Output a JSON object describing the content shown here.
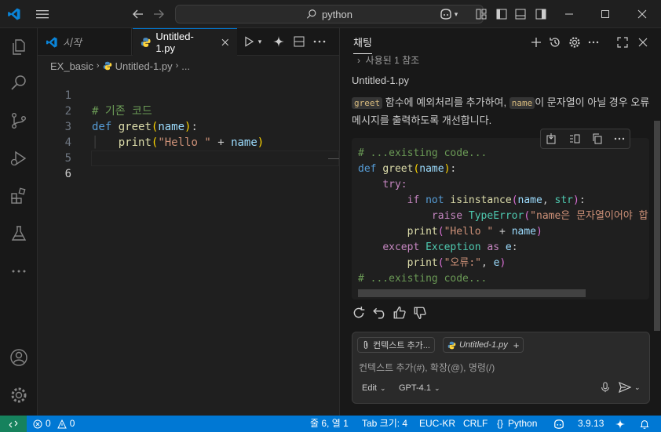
{
  "titlebar": {
    "search": "python",
    "colors": {
      "bg": "#1f1f1f",
      "accent": "#0078d4"
    }
  },
  "activitybar": {
    "items": [
      "explorer-icon",
      "search-icon",
      "source-control-icon",
      "run-debug-icon",
      "extensions-icon",
      "testing-icon",
      "more-icon",
      "account-icon",
      "settings-gear-icon"
    ]
  },
  "editor": {
    "tabs": [
      {
        "label": "시작"
      },
      {
        "label": "Untitled-1.py"
      }
    ],
    "breadcrumb": [
      "EX_basic",
      "Untitled-1.py",
      "..."
    ],
    "lines": [
      {
        "n": "1",
        "text": "# 기존 코드"
      },
      {
        "n": "2",
        "text": "def greet(name):"
      },
      {
        "n": "3",
        "text": "    print(\"Hello \" + name)"
      },
      {
        "n": "4",
        "text": ""
      },
      {
        "n": "5",
        "text": ""
      },
      {
        "n": "6",
        "text": ""
      }
    ],
    "code": {
      "l1": "# 기존 코드",
      "l2_kw": "def",
      "l2_fn": "greet",
      "l2_param": "name",
      "l3_fn": "print",
      "l3_str": "\"Hello \"",
      "l3_var": "name"
    }
  },
  "chat": {
    "title": "채팅",
    "refs": "사용된 1 참조",
    "file": "Untitled-1.py",
    "msg": {
      "code1": "greet",
      "text1": "함수에 예외처리를 추가하여,",
      "code2": "name",
      "text2": "이 문자열이 아닐 경우 오류 메시지를 출력하도록 개선합니다."
    },
    "codeblock": {
      "c1": "# ...existing code...",
      "def": "def",
      "greet": "greet",
      "name": "name",
      "try": "try:",
      "if": "if",
      "not": "not",
      "isinstance": "isinstance",
      "str": "str",
      "raise": "raise",
      "typeerror": "TypeError",
      "errmsg": "\"name은 문자열이어야 합!",
      "print": "print",
      "hello": "\"Hello \"",
      "except": "except",
      "exception": "Exception",
      "as": "as",
      "e": "e",
      "err": "\"오류:\"",
      "c2": "# ...existing code..."
    },
    "input": {
      "chip1": "컨텍스트 추가...",
      "chip2": "Untitled-1.py",
      "placeholder": "컨텍스트 추가(#), 확장(@), 명령(/)",
      "mode": "Edit",
      "model": "GPT-4.1"
    }
  },
  "statusbar": {
    "errors": "0",
    "warnings": "0",
    "position": "줄 6, 열 1",
    "tabsize": "Tab 크기: 4",
    "encoding": "EUC-KR",
    "eol": "CRLF",
    "lang": "Python",
    "version": "3.9.13"
  }
}
